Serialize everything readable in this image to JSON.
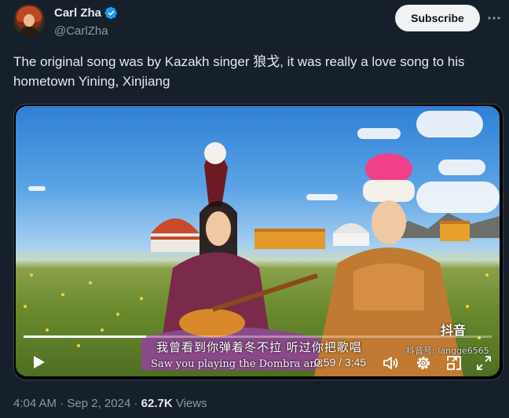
{
  "author": {
    "name": "Carl Zha",
    "handle": "@CarlZha",
    "verified": true
  },
  "actions": {
    "subscribe_label": "Subscribe"
  },
  "tweet": {
    "text": "The original song was by Kazakh singer 狼戈, it was really a love song to his hometown Yining, Xinjiang"
  },
  "video": {
    "subtitle_cn": "我曾看到你弹着冬不拉 听过你把歌唱",
    "subtitle_en": "Saw you playing the Dombra and",
    "watermark": "抖音",
    "watermark_id": "抖音号: langge6565",
    "current_time": "0:59",
    "duration": "3:45",
    "time_separator": " / ",
    "progress": 0.262
  },
  "meta": {
    "time": "4:04 AM",
    "date": "Sep 2, 2024",
    "views_count": "62.7K",
    "views_label": "Views",
    "separator": "·"
  },
  "colors": {
    "background": "#15202b",
    "text": "#e7e9ea",
    "muted": "#8b98a5",
    "verified": "#1d9bf0"
  }
}
